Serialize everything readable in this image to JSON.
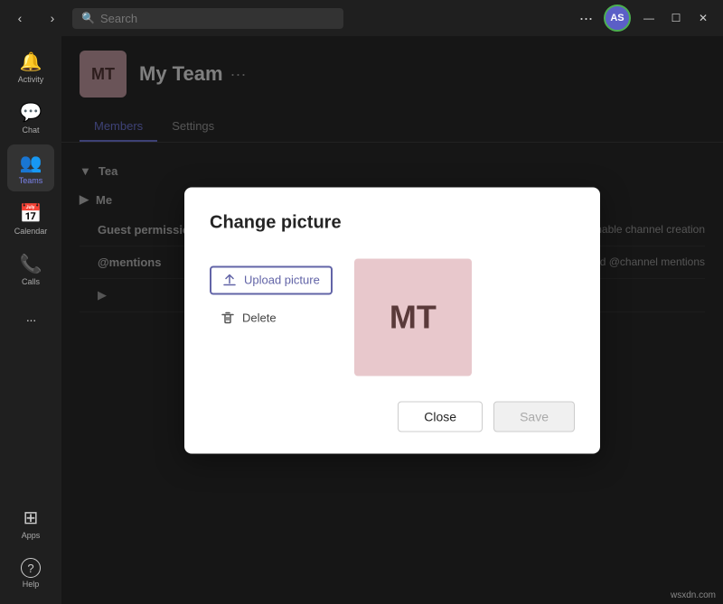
{
  "titleBar": {
    "searchPlaceholder": "Search",
    "userInitials": "AS",
    "navBack": "‹",
    "navForward": "›",
    "dotsLabel": "···",
    "minimize": "—",
    "maximize": "☐",
    "close": "✕"
  },
  "sidebar": {
    "items": [
      {
        "id": "activity",
        "label": "Activity",
        "icon": "🔔"
      },
      {
        "id": "chat",
        "label": "Chat",
        "icon": "💬"
      },
      {
        "id": "teams",
        "label": "Teams",
        "icon": "👥"
      },
      {
        "id": "calendar",
        "label": "Calendar",
        "icon": "📅"
      },
      {
        "id": "calls",
        "label": "Calls",
        "icon": "📞"
      },
      {
        "id": "more",
        "label": "···",
        "icon": "···"
      }
    ],
    "bottomItems": [
      {
        "id": "apps",
        "label": "Apps",
        "icon": "⊞"
      },
      {
        "id": "help",
        "label": "Help",
        "icon": "?"
      }
    ]
  },
  "teamHeader": {
    "initials": "MT",
    "name": "My Team",
    "menuDots": "···"
  },
  "tabs": [
    {
      "id": "members",
      "label": "Members",
      "active": true
    },
    {
      "id": "settings",
      "label": "Settings"
    }
  ],
  "sections": [
    {
      "id": "team",
      "label": "Tea",
      "arrow": "▼",
      "collapsed": false
    },
    {
      "id": "member-permissions",
      "label": "Me",
      "arrow": "▶",
      "collapsed": true
    },
    {
      "id": "guest-permissions",
      "label": "Guest permissions",
      "arrow": "▶",
      "value": "Enable channel creation"
    },
    {
      "id": "mentions",
      "label": "@mentions",
      "arrow": "▶",
      "value": "Choose who can use @team and @channel mentions"
    },
    {
      "id": "extra",
      "label": "",
      "arrow": "▶",
      "value": ""
    }
  ],
  "modal": {
    "title": "Change picture",
    "uploadLabel": "Upload picture",
    "deleteLabel": "Delete",
    "previewInitials": "MT",
    "closeLabel": "Close",
    "saveLabel": "Save"
  },
  "watermark": "wsxdn.com"
}
